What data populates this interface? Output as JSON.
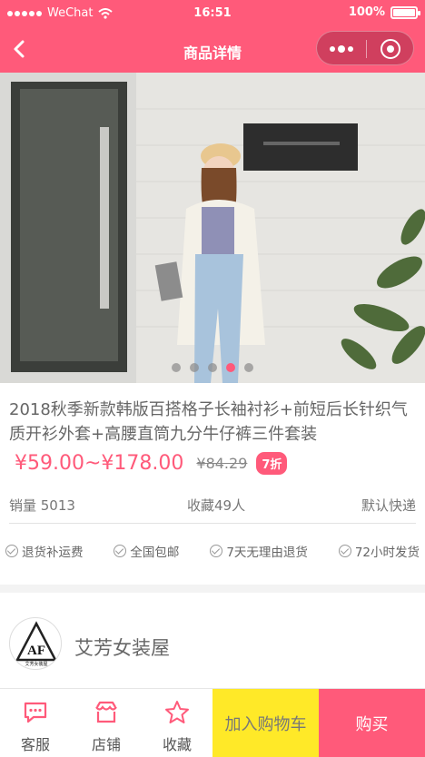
{
  "status": {
    "carrier": "WeChat",
    "time": "16:51",
    "battery": "100%"
  },
  "nav": {
    "title": "商品详情"
  },
  "colors": {
    "accent": "#ff5a7a",
    "cart_yellow": "#ffe928"
  },
  "gallery": {
    "total": 5,
    "active": 4
  },
  "product": {
    "title": "2018秋季新款韩版百搭格子长袖衬衫+前短后长针织气质开衫外套+高腰直筒九分牛仔裤三件套装",
    "price_range": "¥59.00~¥178.00",
    "original_price": "¥84.29",
    "discount": "7折"
  },
  "meta": {
    "sales": "销量 5013",
    "favorites": "收藏49人",
    "shipping": "默认快递"
  },
  "guarantees": [
    "退货补运费",
    "全国包邮",
    "7天无理由退货",
    "72小时发货"
  ],
  "shop": {
    "name": "艾芳女装屋",
    "logo_text": "AF",
    "logo_subtext": "艾芳女装屋"
  },
  "bottom": {
    "service": "客服",
    "store": "店铺",
    "favorite": "收藏",
    "add_to_cart": "加入购物车",
    "buy": "购买"
  }
}
